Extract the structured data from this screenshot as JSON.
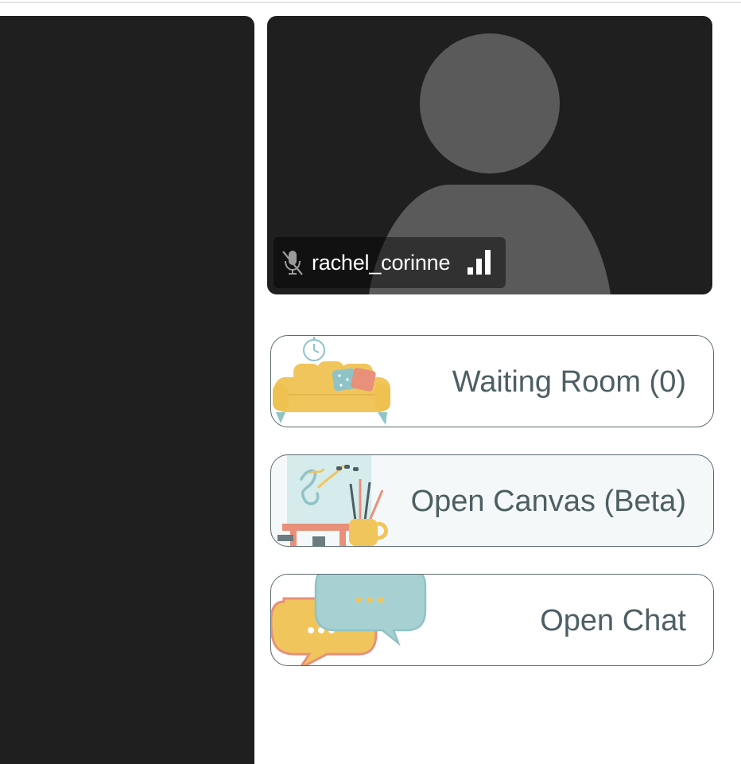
{
  "participant": {
    "name": "rachel_corinne",
    "mic_icon": "mic-muted-icon",
    "signal_icon": "signal-strength-icon"
  },
  "actions": {
    "waiting_room": {
      "label": "Waiting Room (0)",
      "icon": "sofa-illustration"
    },
    "open_canvas": {
      "label": "Open Canvas (Beta)",
      "icon": "easel-illustration"
    },
    "open_chat": {
      "label": "Open Chat",
      "icon": "chat-bubbles-illustration"
    }
  },
  "colors": {
    "panel_background": "#1f1f1f",
    "avatar_placeholder": "#5a5a5a",
    "card_border": "#5a6a6e",
    "card_text": "#4d5f63",
    "accent_yellow": "#f0c55c",
    "accent_teal": "#a6d0d2",
    "accent_salmon": "#e8907a"
  }
}
